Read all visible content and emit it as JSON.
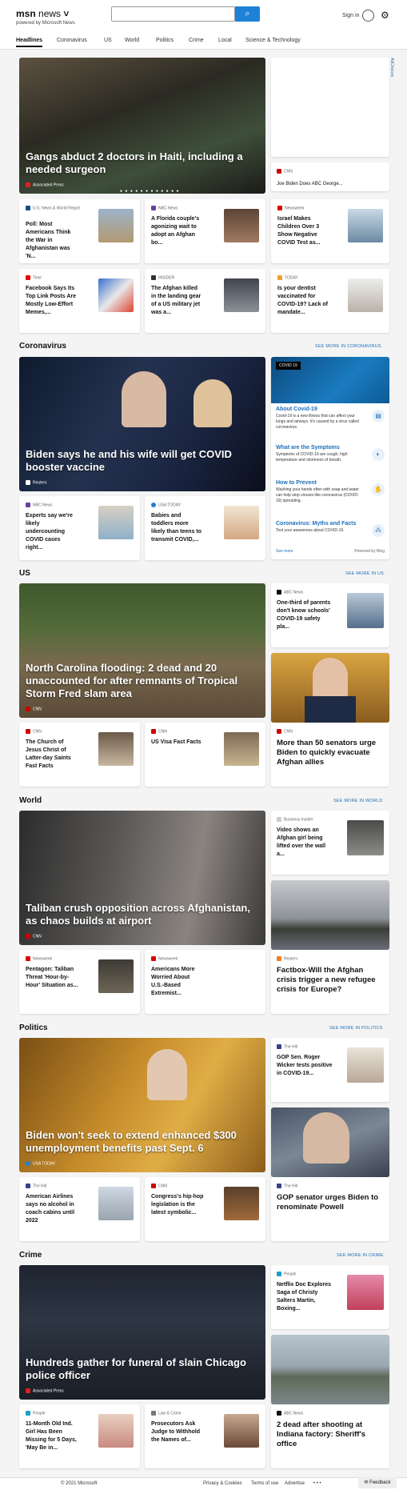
{
  "header": {
    "logo": "msn",
    "logo_section": "news",
    "logo_sub": "powered by Microsoft News",
    "search_placeholder": "",
    "signin": "Sign in"
  },
  "nav": [
    "Headlines",
    "Coronavirus",
    "US",
    "World",
    "Politics",
    "Crime",
    "Local",
    "Science & Technology"
  ],
  "top": {
    "hero": {
      "title": "Gangs abduct 2 doctors in Haiti, including a needed surgeon",
      "source": "Associated Press"
    },
    "adchoices": "AdChoices",
    "side_ad": {
      "source": "CNN",
      "title": "Joe Biden Does ABC George..."
    },
    "row1": [
      {
        "source": "U.S. News & World Report",
        "title": "Poll: Most Americans Think the War in Afghanistan was 'N..."
      },
      {
        "source": "NBC News",
        "title": "A Florida couple's agonizing wait to adopt an Afghan bo..."
      },
      {
        "source": "Newsweek",
        "title": "Israel Makes Children Over 3 Show Negative COVID Test as..."
      }
    ],
    "row2": [
      {
        "source": "Time",
        "title": "Facebook Says Its Top Link Posts Are Mostly Low-Effort Memes,..."
      },
      {
        "source": "INSIDER",
        "title": "The Afghan killed in the landing gear of a US military jet was a..."
      },
      {
        "source": "TODAY",
        "title": "Is your dentist vaccinated for COVID-19? Lack of mandate..."
      }
    ]
  },
  "coronavirus": {
    "heading": "Coronavirus",
    "more": "SEE MORE IN CORONAVIRUS",
    "hero": {
      "title": "Biden says he and his wife will get COVID booster vaccine",
      "source": "Reuters"
    },
    "cards": [
      {
        "source": "NBC News",
        "title": "Experts say we're likely undercounting COVID cases right..."
      },
      {
        "source": "USA TODAY",
        "title": "Babies and toddlers more likely than teens to transmit COVID,..."
      }
    ],
    "panel": {
      "tag": "COVID 19",
      "items": [
        {
          "h": "About Covid-19",
          "d": "Covid-19 is a new illness that can affect your lungs and airways. It's caused by a virus called coronavirus."
        },
        {
          "h": "What are the Symptoms",
          "d": "Symptoms of COVID-19 are cough, high temperature and shortness of breath."
        },
        {
          "h": "How to Prevent",
          "d": "Washing your hands often with soap and water can help stop viruses like coronavirus (COVID-19) spreading."
        },
        {
          "h": "Coronavirus: Myths and Facts",
          "d": "Test your awareness about COVID-19."
        }
      ],
      "see_more": "See more",
      "powered": "Powered by Bing"
    }
  },
  "us": {
    "heading": "US",
    "more": "SEE MORE IN US",
    "hero": {
      "title": "North Carolina flooding: 2 dead and 20 unaccounted for after remnants of Tropical Storm Fred slam area",
      "source": "CNN"
    },
    "side": {
      "source": "ABC News",
      "title": "One-third of parents don't know schools' COVID-19 safety pla..."
    },
    "cards": [
      {
        "source": "CNN",
        "title": "The Church of Jesus Christ of Latter-day Saints Fast Facts"
      },
      {
        "source": "CNN",
        "title": "US Visa Fast Facts"
      }
    ],
    "big": {
      "source": "CNN",
      "title": "More than 50 senators urge Biden to quickly evacuate Afghan allies"
    }
  },
  "world": {
    "heading": "World",
    "more": "SEE MORE IN WORLD",
    "hero": {
      "title": "Taliban crush opposition across Afghanistan, as chaos builds at airport",
      "source": "CNN"
    },
    "side": {
      "source": "Business Insider",
      "title": "Video shows an Afghan girl being lifted over the wall a..."
    },
    "cards": [
      {
        "source": "Newsweek",
        "title": "Pentagon: Taliban Threat 'Hour-by-Hour' Situation as..."
      },
      {
        "source": "Newsweek",
        "title": "Americans More Worried About U.S.-Based Extremist..."
      }
    ],
    "big": {
      "source": "Reuters",
      "title": "Factbox-Will the Afghan crisis trigger a new refugee crisis for Europe?"
    }
  },
  "politics": {
    "heading": "Politics",
    "more": "SEE MORE IN POLITICS",
    "hero": {
      "title": "Biden won't seek to extend enhanced $300 unemployment benefits past Sept. 6",
      "source": "USA TODAY"
    },
    "side": {
      "source": "The Hill",
      "title": "GOP Sen. Roger Wicker tests positive in COVID-19..."
    },
    "cards": [
      {
        "source": "The Hill",
        "title": "American Airlines says no alcohol in coach cabins until 2022"
      },
      {
        "source": "CNN",
        "title": "Congress's hip-hop legislation is the latest symbolic..."
      }
    ],
    "big": {
      "source": "The Hill",
      "title": "GOP senator urges Biden to renominate Powell"
    }
  },
  "crime": {
    "heading": "Crime",
    "more": "SEE MORE IN CRIME",
    "hero": {
      "title": "Hundreds gather for funeral of slain Chicago police officer",
      "source": "Associated Press"
    },
    "side": {
      "source": "People",
      "title": "Netflix Doc Explores Saga of Christy Salters Martin, Boxing..."
    },
    "cards": [
      {
        "source": "People",
        "title": "11-Month Old Ind. Girl Has Been Missing for 5 Days, 'May Be in..."
      },
      {
        "source": "Law & Crime",
        "title": "Prosecutors Ask Judge to Withhold the Names of..."
      }
    ],
    "big": {
      "source": "ABC News",
      "title": "2 dead after shooting at Indiana factory: Sheriff's office"
    }
  },
  "footer": {
    "copyright": "© 2021 Microsoft",
    "privacy": "Privacy & Cookies",
    "terms": "Terms of use",
    "advertise": "Advertise",
    "more": "• • •",
    "feedback": "Feedback"
  }
}
